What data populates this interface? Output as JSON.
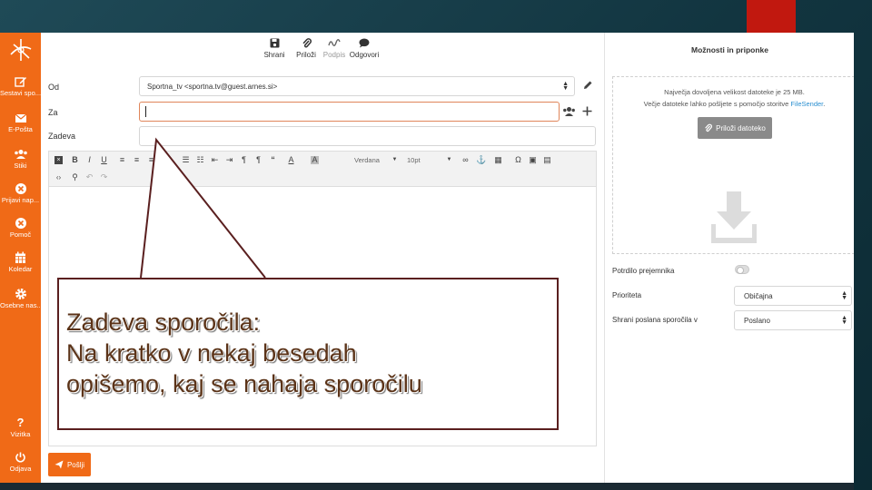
{
  "sidebar": {
    "items": [
      {
        "label": "Sestavi spo...",
        "icon": "edit-icon"
      },
      {
        "label": "E-Pošta",
        "icon": "mail-icon"
      },
      {
        "label": "Stiki",
        "icon": "contacts-icon"
      },
      {
        "label": "Prijavi nap...",
        "icon": "report-icon"
      },
      {
        "label": "Pomoč",
        "icon": "help-circle-icon"
      },
      {
        "label": "Koledar",
        "icon": "calendar-icon"
      },
      {
        "label": "Osebne nas...",
        "icon": "gear-icon"
      },
      {
        "label": "Vizitka",
        "icon": "question-icon"
      },
      {
        "label": "Odjava",
        "icon": "power-icon"
      }
    ]
  },
  "toolbar": {
    "save_label": "Shrani",
    "attach_label": "Priloži",
    "signature_label": "Podpis",
    "replies_label": "Odgovori"
  },
  "form": {
    "from_label": "Od",
    "from_value": "Sportna_tv <sportna.tv@guest.arnes.si>",
    "to_label": "Za",
    "subject_label": "Zadeva"
  },
  "editor": {
    "font_name": "Verdana",
    "font_size": "10pt"
  },
  "send_label": "Pošlji",
  "right": {
    "title": "Možnosti in priponke",
    "info_line1": "Največja dovoljena velikost datoteke je 25 MB.",
    "info_line2_prefix": "Večje datoteke lahko pošljete s pomočjo storitve ",
    "info_link": "FileSender",
    "info_line2_suffix": ".",
    "attach_button": "Priloži datoteko",
    "read_receipt_label": "Potrdilo prejemnika",
    "priority_label": "Prioriteta",
    "priority_value": "Običajna",
    "save_sent_label": "Shrani poslana sporočila v",
    "save_sent_value": "Poslano"
  },
  "callout": {
    "line1": "Zadeva sporočila:",
    "line2": "Na kratko v nekaj besedah",
    "line3": "opišemo, kaj se nahaja sporočilu"
  },
  "colors": {
    "accent": "#f06a17",
    "slide_red": "#c1180f",
    "callout_border": "#5a1f1f",
    "link": "#2a8fd0"
  }
}
